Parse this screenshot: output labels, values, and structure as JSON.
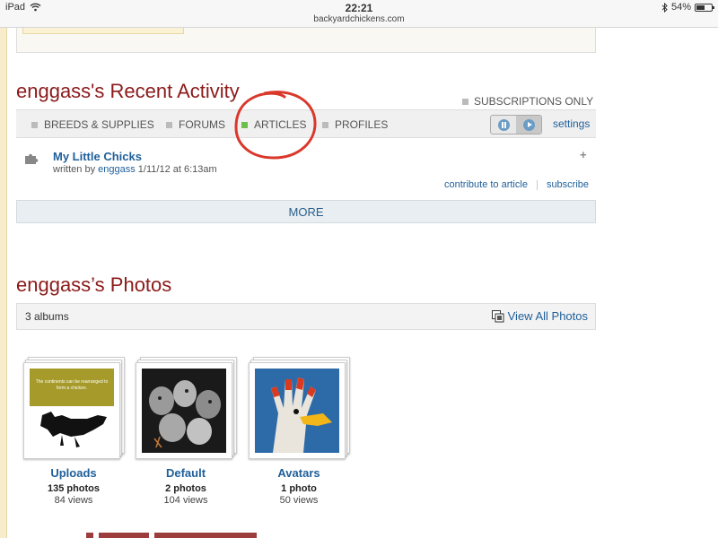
{
  "status_bar": {
    "device": "iPad",
    "time": "22:21",
    "url": "backyardchickens.com",
    "battery": "54%",
    "battery_level": 0.54
  },
  "activity": {
    "title": "enggass's Recent Activity",
    "subscriptions_only": "SUBSCRIPTIONS ONLY",
    "tabs": [
      {
        "label": "BREEDS & SUPPLIES",
        "active": false
      },
      {
        "label": "FORUMS",
        "active": false
      },
      {
        "label": "ARTICLES",
        "active": true
      },
      {
        "label": "PROFILES",
        "active": false
      }
    ],
    "settings": "settings",
    "item": {
      "title": "My Little Chicks",
      "written_by": "written by",
      "author": "enggass",
      "date": "1/11/12 at 6:13am",
      "contribute": "contribute to article",
      "subscribe": "subscribe"
    },
    "more": "MORE"
  },
  "photos": {
    "title": "enggass’s Photos",
    "albums_count": "3 albums",
    "view_all": "View All Photos",
    "albums": [
      {
        "name": "Uploads",
        "count": "135 photos",
        "views": "84 views",
        "thumb_caption": "The continents can be rearranged to form a chicken."
      },
      {
        "name": "Default",
        "count": "2 photos",
        "views": "104 views"
      },
      {
        "name": "Avatars",
        "count": "1 photo",
        "views": "50 views"
      }
    ]
  },
  "colors": {
    "heading": "#8b1a1a",
    "link": "#1f5f9a",
    "active_tab": "#6cbf4a",
    "annotation": "#d9382b"
  },
  "icons": [
    "wifi-icon",
    "bluetooth-icon",
    "battery-icon",
    "checkbox-icon",
    "pause-icon",
    "play-icon",
    "puzzle-icon",
    "plus-icon",
    "photos-stack-icon"
  ]
}
